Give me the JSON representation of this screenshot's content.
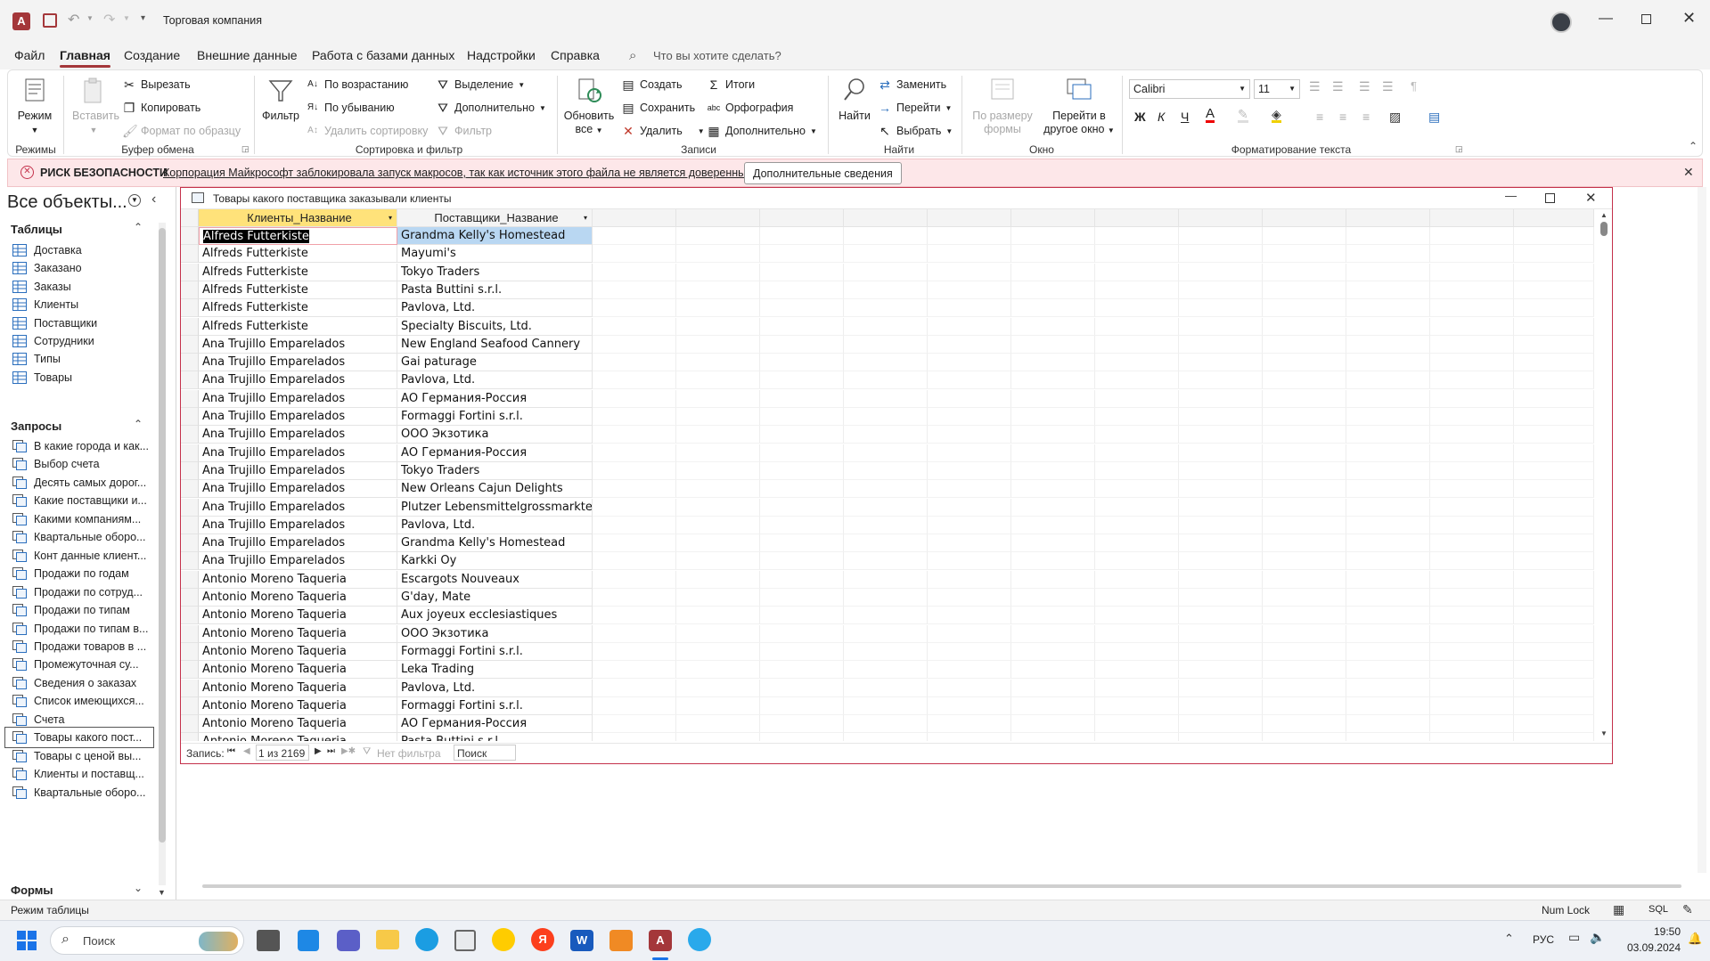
{
  "app": {
    "title": "Торговая компания",
    "quick_access": [
      "save-icon",
      "undo-icon",
      "redo-icon",
      "customize-icon"
    ]
  },
  "tabs": [
    "Файл",
    "Главная",
    "Создание",
    "Внешние данные",
    "Работа с базами данных",
    "Надстройки",
    "Справка"
  ],
  "active_tab": "Главная",
  "tell_me": "Что вы хотите сделать?",
  "ribbon": {
    "views": {
      "label": "Режимы",
      "mode": "Режим"
    },
    "clipboard": {
      "label": "Буфер обмена",
      "paste": "Вставить",
      "cut": "Вырезать",
      "copy": "Копировать",
      "format_painter": "Формат по образцу"
    },
    "sort_filter": {
      "label": "Сортировка и фильтр",
      "filter": "Фильтр",
      "ascending": "По возрастанию",
      "descending": "По убыванию",
      "remove_sort": "Удалить сортировку",
      "selection": "Выделение",
      "advanced": "Дополнительно",
      "toggle_filter": "Фильтр"
    },
    "records": {
      "label": "Записи",
      "refresh": "Обновить",
      "refresh2": "все",
      "new": "Создать",
      "save": "Сохранить",
      "delete": "Удалить",
      "totals": "Итоги",
      "spelling": "Орфография",
      "more": "Дополнительно"
    },
    "find": {
      "label": "Найти",
      "find": "Найти",
      "replace": "Заменить",
      "goto": "Перейти",
      "select": "Выбрать"
    },
    "window": {
      "label": "Окно",
      "fit": "По размеру",
      "fit2": "формы",
      "switch": "Перейти в",
      "switch2": "другое окно"
    },
    "text": {
      "label": "Форматирование текста",
      "font": "Calibri",
      "size": "11",
      "bold": "Ж",
      "italic": "К",
      "underline": "Ч"
    }
  },
  "security": {
    "title": "РИСК БЕЗОПАСНОСТИ",
    "message": "Корпорация Майкрософт заблокировала запуск макросов, так как источник этого файла не является доверенным.",
    "button": "Дополнительные сведения"
  },
  "nav": {
    "title": "Все объекты...",
    "groups": {
      "tables": "Таблицы",
      "queries": "Запросы",
      "forms": "Формы"
    },
    "tables": [
      "Доставка",
      "Заказано",
      "Заказы",
      "Клиенты",
      "Поставщики",
      "Сотрудники",
      "Типы",
      "Товары"
    ],
    "queries": [
      "В какие города и как...",
      "Выбор счета",
      "Десять самых дорог...",
      "Какие поставщики и...",
      "Какими компаниям...",
      "Квартальные оборо...",
      "Конт данные клиент...",
      "Продажи по годам",
      "Продажи по сотруд...",
      "Продажи по типам",
      "Продажи по типам в...",
      "Продажи товаров в ...",
      "Промежуточная су...",
      "Сведения о заказах",
      "Список имеющихся...",
      "Счета",
      "Товары какого пост...",
      "Товары с ценой вы...",
      "Клиенты и поставщ...",
      "Квартальные оборо..."
    ],
    "selected_index": 16
  },
  "doc": {
    "title": "Товары какого поставщика заказывали клиенты",
    "columns": [
      "Клиенты_Название",
      "Поставщики_Название"
    ],
    "rows": [
      [
        "Alfreds Futterkiste",
        "Grandma Kelly's Homestead"
      ],
      [
        "Alfreds Futterkiste",
        "Mayumi's"
      ],
      [
        "Alfreds Futterkiste",
        "Tokyo Traders"
      ],
      [
        "Alfreds Futterkiste",
        "Pasta Buttini s.r.l."
      ],
      [
        "Alfreds Futterkiste",
        "Pavlova, Ltd."
      ],
      [
        "Alfreds Futterkiste",
        "Specialty Biscuits, Ltd."
      ],
      [
        "Ana Trujillo Emparelados",
        "New England Seafood Cannery"
      ],
      [
        "Ana Trujillo Emparelados",
        "Gai paturage"
      ],
      [
        "Ana Trujillo Emparelados",
        "Pavlova, Ltd."
      ],
      [
        "Ana Trujillo Emparelados",
        "АО Германия-Россия"
      ],
      [
        "Ana Trujillo Emparelados",
        "Formaggi Fortini s.r.l."
      ],
      [
        "Ana Trujillo Emparelados",
        "ООО Экзотика"
      ],
      [
        "Ana Trujillo Emparelados",
        "АО Германия-Россия"
      ],
      [
        "Ana Trujillo Emparelados",
        "Tokyo Traders"
      ],
      [
        "Ana Trujillo Emparelados",
        "New Orleans Cajun Delights"
      ],
      [
        "Ana Trujillo Emparelados",
        "Plutzer Lebensmittelgrossmarkte A"
      ],
      [
        "Ana Trujillo Emparelados",
        "Pavlova, Ltd."
      ],
      [
        "Ana Trujillo Emparelados",
        "Grandma Kelly's Homestead"
      ],
      [
        "Ana Trujillo Emparelados",
        "Karkki Oy"
      ],
      [
        "Antonio Moreno Taqueria",
        "Escargots Nouveaux"
      ],
      [
        "Antonio Moreno Taqueria",
        "G'day, Mate"
      ],
      [
        "Antonio Moreno Taqueria",
        "Aux joyeux ecclesiastiques"
      ],
      [
        "Antonio Moreno Taqueria",
        "ООО Экзотика"
      ],
      [
        "Antonio Moreno Taqueria",
        "Formaggi Fortini s.r.l."
      ],
      [
        "Antonio Moreno Taqueria",
        "Leka Trading"
      ],
      [
        "Antonio Moreno Taqueria",
        "Pavlova, Ltd."
      ],
      [
        "Antonio Moreno Taqueria",
        "Formaggi Fortini s.r.l."
      ],
      [
        "Antonio Moreno Taqueria",
        "АО Германия-Россия"
      ],
      [
        "Antonio Moreno Taqueria",
        "Pasta Buttini s.r.l."
      ]
    ],
    "record_label": "Запись:",
    "record_pos": "1 из 2169",
    "no_filter": "Нет фильтра",
    "search": "Поиск"
  },
  "status": {
    "left": "Режим таблицы",
    "numlock": "Num Lock",
    "sql": "SQL"
  },
  "taskbar": {
    "search": "Поиск",
    "lang": "РУС",
    "time": "19:50",
    "date": "03.09.2024"
  },
  "colors": {
    "accent": "#a4373a",
    "selected_header": "#ffe27a",
    "selected_cell": "#b9d7f2",
    "security_bg": "#fde7e9"
  }
}
